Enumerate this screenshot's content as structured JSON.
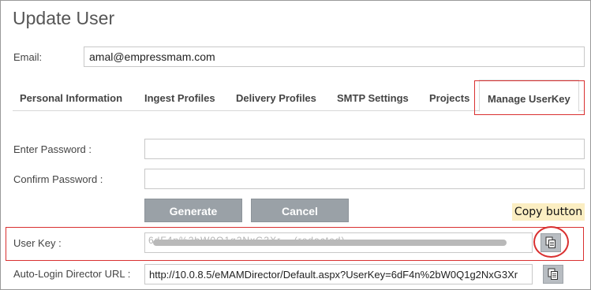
{
  "page": {
    "title": "Update User"
  },
  "email": {
    "label": "Email:",
    "value": "amal@empressmam.com"
  },
  "tabs": [
    {
      "label": "Personal Information",
      "active": false
    },
    {
      "label": "Ingest Profiles",
      "active": false
    },
    {
      "label": "Delivery Profiles",
      "active": false
    },
    {
      "label": "SMTP Settings",
      "active": false
    },
    {
      "label": "Projects",
      "active": false
    },
    {
      "label": "Manage UserKey",
      "active": true
    }
  ],
  "form": {
    "enter_password_label": "Enter Password :",
    "enter_password_value": "",
    "confirm_password_label": "Confirm Password :",
    "confirm_password_value": "",
    "generate_label": "Generate",
    "cancel_label": "Cancel",
    "user_key_label": "User Key :",
    "user_key_value": "6dF4n%2bW0Q1g2NxG3Xr... (redacted)",
    "auto_login_label": "Auto-Login Director URL :",
    "auto_login_value": "http://10.0.8.5/eMAMDirector/Default.aspx?UserKey=6dF4n%2bW0Q1g2NxG3Xr"
  },
  "annotation": {
    "copy_button_callout": "Copy button",
    "highlight_color": "#d93030",
    "callout_bg": "#fbeec2"
  },
  "icons": {
    "copy": "copy-icon"
  }
}
